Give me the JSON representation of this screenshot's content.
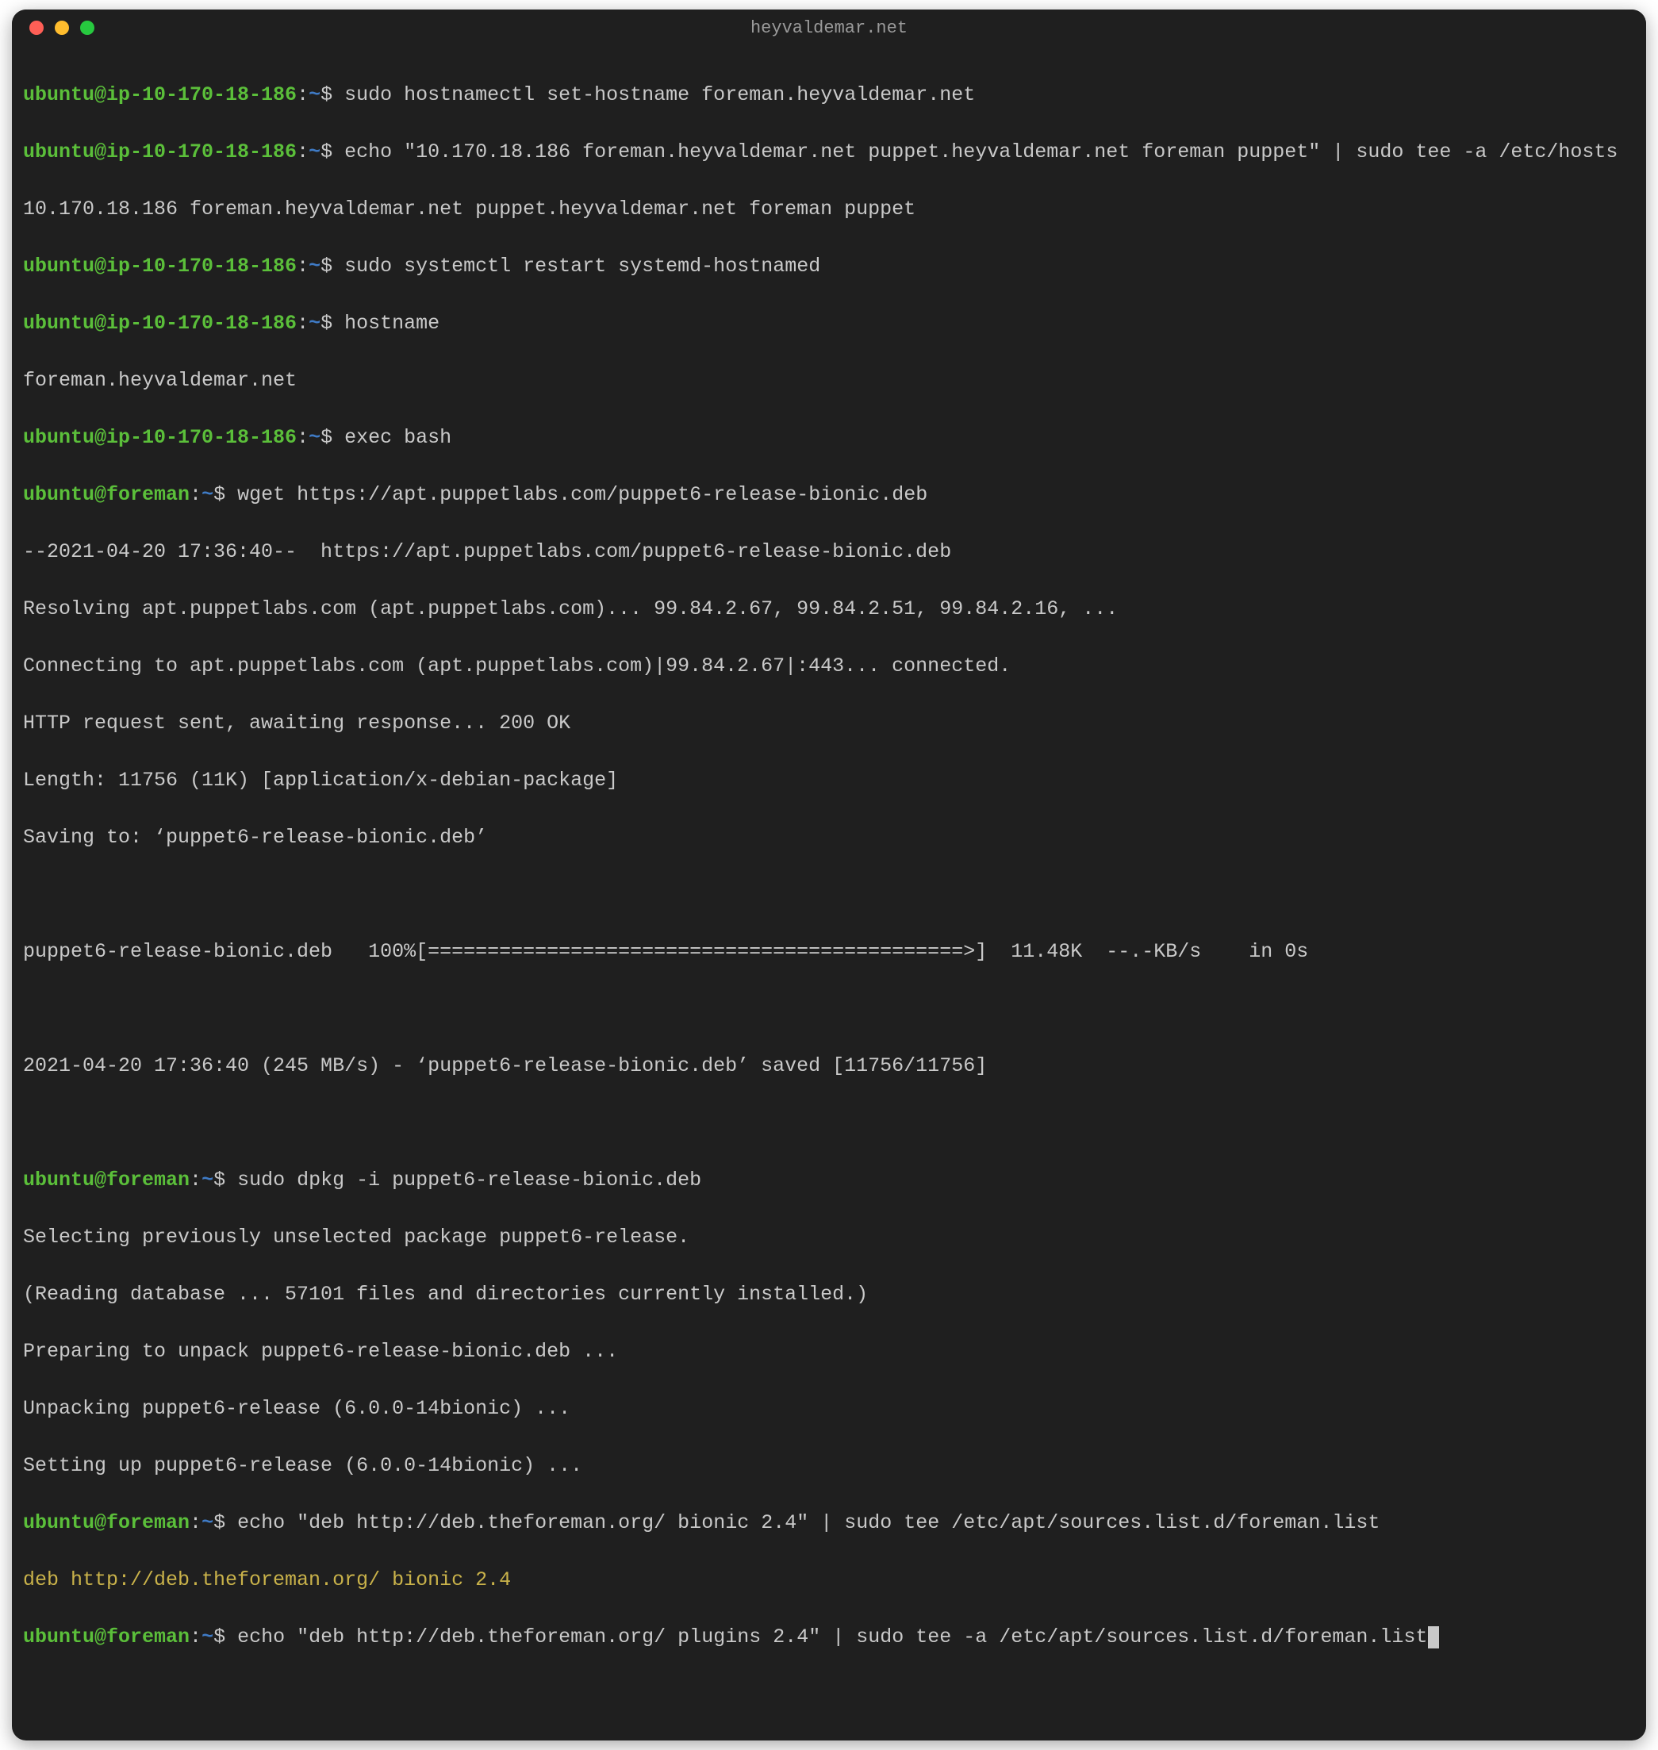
{
  "window": {
    "title": "heyvaldemar.net"
  },
  "prompts": {
    "p1": {
      "user": "ubuntu@ip-10-170-18-186",
      "path": "~"
    },
    "p2": {
      "user": "ubuntu@foreman",
      "path": "~"
    }
  },
  "lines": {
    "c1": "sudo hostnamectl set-hostname foreman.heyvaldemar.net",
    "c2": "echo \"10.170.18.186 foreman.heyvaldemar.net puppet.heyvaldemar.net foreman puppet\" | sudo tee -a /etc/hosts",
    "o2": "10.170.18.186 foreman.heyvaldemar.net puppet.heyvaldemar.net foreman puppet",
    "c3": "sudo systemctl restart systemd-hostnamed",
    "c4": "hostname",
    "o4": "foreman.heyvaldemar.net",
    "c5": "exec bash",
    "c6": "wget https://apt.puppetlabs.com/puppet6-release-bionic.deb",
    "o6a": "--2021-04-20 17:36:40--  https://apt.puppetlabs.com/puppet6-release-bionic.deb",
    "o6b": "Resolving apt.puppetlabs.com (apt.puppetlabs.com)... 99.84.2.67, 99.84.2.51, 99.84.2.16, ...",
    "o6c": "Connecting to apt.puppetlabs.com (apt.puppetlabs.com)|99.84.2.67|:443... connected.",
    "o6d": "HTTP request sent, awaiting response... 200 OK",
    "o6e": "Length: 11756 (11K) [application/x-debian-package]",
    "o6f": "Saving to: ‘puppet6-release-bionic.deb’",
    "o6g": "puppet6-release-bionic.deb   100%[=============================================>]  11.48K  --.-KB/s    in 0s",
    "o6h": "2021-04-20 17:36:40 (245 MB/s) - ‘puppet6-release-bionic.deb’ saved [11756/11756]",
    "c7": "sudo dpkg -i puppet6-release-bionic.deb",
    "o7a": "Selecting previously unselected package puppet6-release.",
    "o7b": "(Reading database ... 57101 files and directories currently installed.)",
    "o7c": "Preparing to unpack puppet6-release-bionic.deb ...",
    "o7d": "Unpacking puppet6-release (6.0.0-14bionic) ...",
    "o7e": "Setting up puppet6-release (6.0.0-14bionic) ...",
    "c8": "echo \"deb http://deb.theforeman.org/ bionic 2.4\" | sudo tee /etc/apt/sources.list.d/foreman.list",
    "o8": "deb http://deb.theforeman.org/ bionic 2.4",
    "c9": "echo \"deb http://deb.theforeman.org/ plugins 2.4\" | sudo tee -a /etc/apt/sources.list.d/foreman.list"
  }
}
